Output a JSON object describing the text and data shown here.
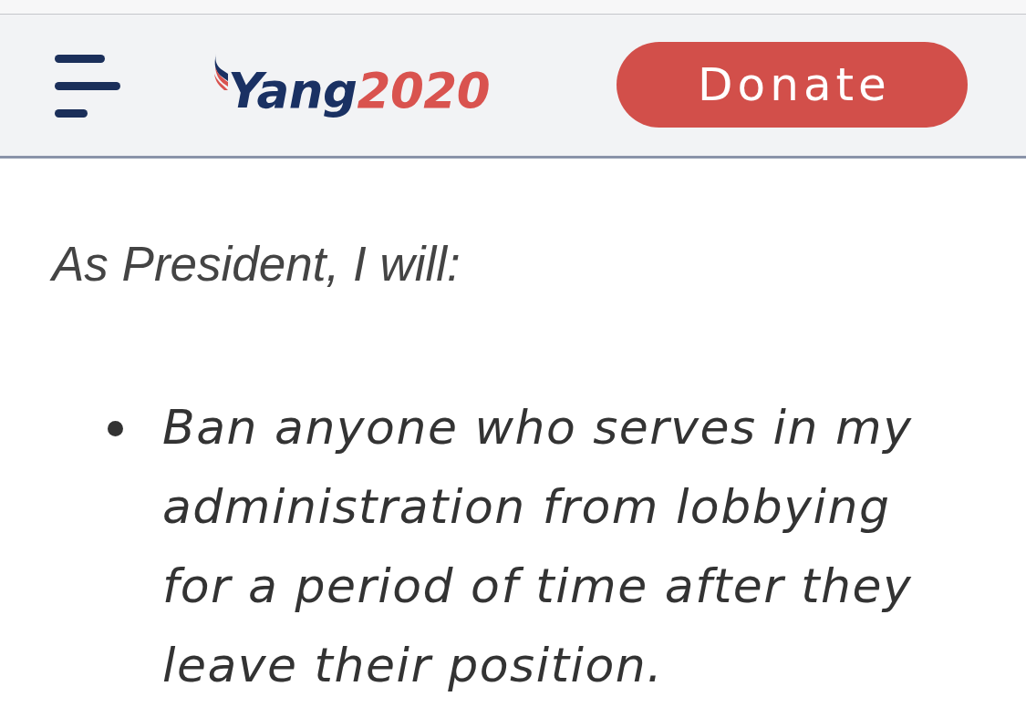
{
  "header": {
    "logo": {
      "name": "Yang",
      "year": "2020"
    },
    "donate_button": "Donate"
  },
  "content": {
    "intro": "As President, I will:",
    "bullets": [
      "Ban anyone who serves in my administration from lobbying for a period of time after they leave their position."
    ]
  }
}
